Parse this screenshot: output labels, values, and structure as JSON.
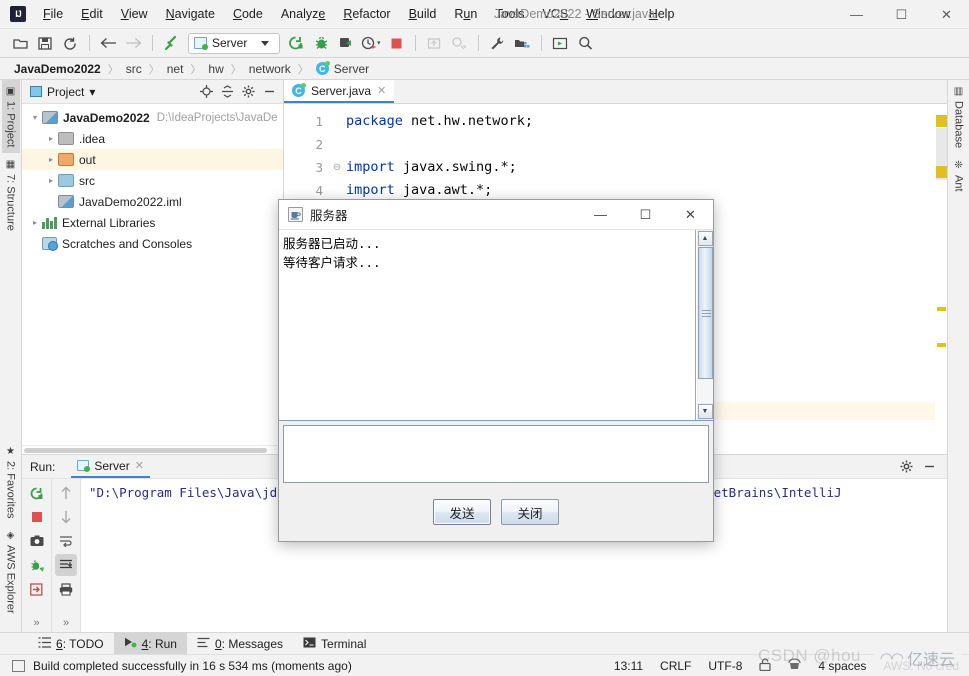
{
  "window": {
    "title": "JavaDemo2022 - Server.java",
    "logo": "intellij-idea-logo",
    "minimize": "—",
    "maximize": "☐",
    "close": "✕"
  },
  "menubar": {
    "items": [
      {
        "label": "File"
      },
      {
        "label": "Edit"
      },
      {
        "label": "View"
      },
      {
        "label": "Navigate"
      },
      {
        "label": "Code"
      },
      {
        "label": "Analyze"
      },
      {
        "label": "Refactor"
      },
      {
        "label": "Build"
      },
      {
        "label": "Run"
      },
      {
        "label": "Tools"
      },
      {
        "label": "VCS"
      },
      {
        "label": "Window"
      },
      {
        "label": "Help"
      }
    ]
  },
  "toolbar": {
    "open_icon": "folder-open-icon",
    "save_icon": "save-icon",
    "sync_icon": "refresh-icon",
    "back_icon": "arrow-left-icon",
    "forward_icon": "arrow-right-icon",
    "build_icon": "hammer-icon",
    "run_config": {
      "label": "Server",
      "icon": "run-config-icon",
      "caret": "▾"
    },
    "run_icon": "run-icon",
    "debug_icon": "debug-icon",
    "coverage_icon": "run-coverage-icon",
    "profile_icon": "profiler-icon",
    "stop_icon": "stop-icon",
    "update_icon": "update-project-icon",
    "commit_icon": "commit-icon",
    "wrench_icon": "settings-wrench-icon",
    "structure_icon": "project-structure-icon",
    "select_in_icon": "select-in-icon",
    "search_icon": "search-icon"
  },
  "breadcrumb": {
    "items": [
      "JavaDemo2022",
      "src",
      "net",
      "hw",
      "network",
      "Server"
    ],
    "separator": "〉",
    "class_icon": "java-class-icon"
  },
  "left_stripe": {
    "items": [
      {
        "label": "1: Project",
        "icon": "project-icon",
        "active": true
      },
      {
        "label": "7: Structure",
        "icon": "structure-icon",
        "active": false
      }
    ],
    "bottom_items": [
      {
        "label": "2: Favorites",
        "icon": "star-icon",
        "active": false
      },
      {
        "label": "AWS Explorer",
        "icon": "aws-icon",
        "active": false
      }
    ]
  },
  "right_stripe": {
    "items": [
      {
        "label": "Database",
        "icon": "database-icon"
      },
      {
        "label": "Ant",
        "icon": "ant-icon"
      }
    ]
  },
  "project_panel": {
    "title": "Project",
    "caret": "▾",
    "header_icons": [
      "locate-icon",
      "collapse-all-icon",
      "gear-icon",
      "hide-icon"
    ],
    "tree": [
      {
        "label": "JavaDemo2022",
        "path": "D:\\IdeaProjects\\JavaDe",
        "icon": "module-icon",
        "arrow": "▾",
        "bold": true,
        "depth": 0,
        "highlight": false
      },
      {
        "label": ".idea",
        "path": "",
        "icon": "folder-grey-icon",
        "arrow": "▸",
        "bold": false,
        "depth": 1,
        "highlight": false
      },
      {
        "label": "out",
        "path": "",
        "icon": "folder-orange-icon",
        "arrow": "▸",
        "bold": false,
        "depth": 1,
        "highlight": true
      },
      {
        "label": "src",
        "path": "",
        "icon": "folder-blue-icon",
        "arrow": "▸",
        "bold": false,
        "depth": 1,
        "highlight": false
      },
      {
        "label": "JavaDemo2022.iml",
        "path": "",
        "icon": "iml-file-icon",
        "arrow": "",
        "bold": false,
        "depth": 1,
        "highlight": false
      },
      {
        "label": "External Libraries",
        "path": "",
        "icon": "libraries-icon",
        "arrow": "▸",
        "bold": false,
        "depth": 0,
        "highlight": false
      },
      {
        "label": "Scratches and Consoles",
        "path": "",
        "icon": "scratches-icon",
        "arrow": "",
        "bold": false,
        "depth": 0,
        "highlight": false
      }
    ]
  },
  "editor": {
    "tab": {
      "label": "Server.java",
      "icon": "java-class-icon",
      "close": "✕"
    },
    "lines": [
      {
        "num": "1",
        "fold": "",
        "text": "package net.hw.network;",
        "kw": "package",
        "rest": " net.hw.network;"
      },
      {
        "num": "2",
        "fold": "",
        "text": "",
        "kw": "",
        "rest": ""
      },
      {
        "num": "3",
        "fold": "⊖",
        "text": "import javax.swing.*;",
        "kw": "import",
        "rest": " javax.swing.*;"
      },
      {
        "num": "4",
        "fold": "",
        "text": "import java.awt.*;",
        "kw": "import",
        "rest": " java.awt.*;"
      }
    ]
  },
  "dialog": {
    "title": "服务器",
    "icon": "java-coffee-cup-icon",
    "minimize": "—",
    "maximize": "☐",
    "close": "✕",
    "log_lines": "服务器已启动...\n等待客户请求...",
    "input_value": "",
    "scroll_up": "▲",
    "scroll_down": "▼",
    "buttons": [
      {
        "label": "发送",
        "name": "send-button"
      },
      {
        "label": "关闭",
        "name": "close-button"
      }
    ]
  },
  "run_window": {
    "label": "Run:",
    "tab": {
      "label": "Server",
      "icon": "run-config-icon",
      "close": "✕"
    },
    "console_text": "\"D:\\Program Files\\Java\\jdk1.8.0_231\\bin\\java.exe\" ... -javaagent:D:\\Program Files\\JetBrains\\IntelliJ",
    "gutter_icons": [
      "rerun-icon",
      "stop-icon",
      "screenshot-icon",
      "thread-dump-icon",
      "export-icon"
    ],
    "gutter_icons_b": [
      "up-icon",
      "down-icon",
      "soft-wrap-icon",
      "scroll-to-end-icon",
      "print-icon"
    ],
    "more": "»",
    "header_icons": [
      "gear-icon",
      "hide-icon"
    ]
  },
  "bottom_tabs": [
    {
      "label": "6: TODO",
      "icon": "todo-icon",
      "active": false
    },
    {
      "label": "4: Run",
      "icon": "run-green-icon",
      "active": true
    },
    {
      "label": "0: Messages",
      "icon": "messages-icon",
      "active": false
    },
    {
      "label": "Terminal",
      "icon": "terminal-icon",
      "active": false
    }
  ],
  "status_bar": {
    "message": "Build completed successfully in 16 s 534 ms (moments ago)",
    "icon": "build-status-icon",
    "position": "13:11",
    "line_separator": "CRLF",
    "encoding": "UTF-8",
    "lock_icon": "read-write-lock-icon",
    "inspection_icon": "inspection-hector-icon",
    "indent": "4 spaces",
    "aws": "AWS: No cred"
  },
  "watermarks": {
    "csdn": "CSDN @hou",
    "yisuyun": "亿速云",
    "cloud_icon": "cloud-logo-icon"
  },
  "colors": {
    "accent_blue": "#4083c9",
    "keyword_blue": "#0033b3",
    "warning_yellow": "#e0c020",
    "highlight_row": "#fdf6e3",
    "console_text": "#2a2a8a"
  }
}
